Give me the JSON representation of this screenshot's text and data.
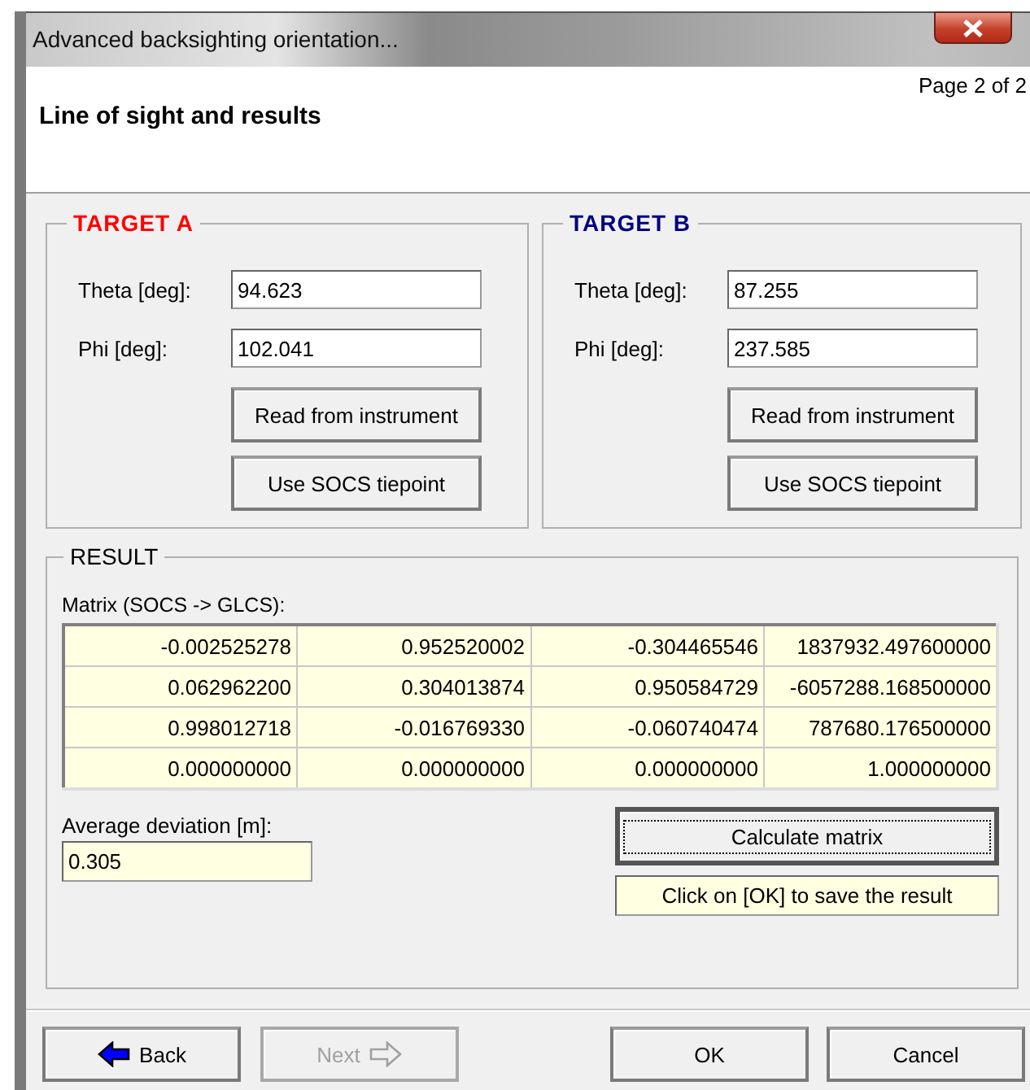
{
  "window": {
    "title": "Advanced backsighting orientation..."
  },
  "header": {
    "page": "Page 2 of 2",
    "title": "Line of sight and results"
  },
  "targets": [
    {
      "title": "TARGET A",
      "color": "#ff0000",
      "theta_label": "Theta [deg]:",
      "theta": "94.623",
      "phi_label": "Phi [deg]:",
      "phi": "102.041",
      "buttons": [
        "Read from instrument",
        "Use SOCS tiepoint"
      ]
    },
    {
      "title": "TARGET B",
      "color": "#000080",
      "theta_label": "Theta [deg]:",
      "theta": "87.255",
      "phi_label": "Phi [deg]:",
      "phi": "237.585",
      "buttons": [
        "Read from instrument",
        "Use SOCS tiepoint"
      ]
    }
  ],
  "result": {
    "title": "RESULT",
    "matrix_label": "Matrix (SOCS -> GLCS):",
    "matrix": [
      [
        "-0.002525278",
        "0.952520002",
        "-0.304465546",
        "1837932.497600000"
      ],
      [
        "0.062962200",
        "0.304013874",
        "0.950584729",
        "-6057288.168500000"
      ],
      [
        "0.998012718",
        "-0.016769330",
        "-0.060740474",
        "787680.176500000"
      ],
      [
        "0.000000000",
        "0.000000000",
        "0.000000000",
        "1.000000000"
      ]
    ],
    "deviation_label": "Average deviation [m]:",
    "deviation": "0.305",
    "calculate_button": {
      "label": "Calculate matrix",
      "focused": true
    },
    "hint": "Click on [OK] to save the result"
  },
  "nav": [
    {
      "kind": "back",
      "label": "Back",
      "disabled": false
    },
    {
      "kind": "next",
      "label": "Next",
      "disabled": true
    },
    {
      "kind": "plain",
      "label": "OK",
      "disabled": false
    },
    {
      "kind": "plain",
      "label": "Cancel",
      "disabled": false
    }
  ]
}
